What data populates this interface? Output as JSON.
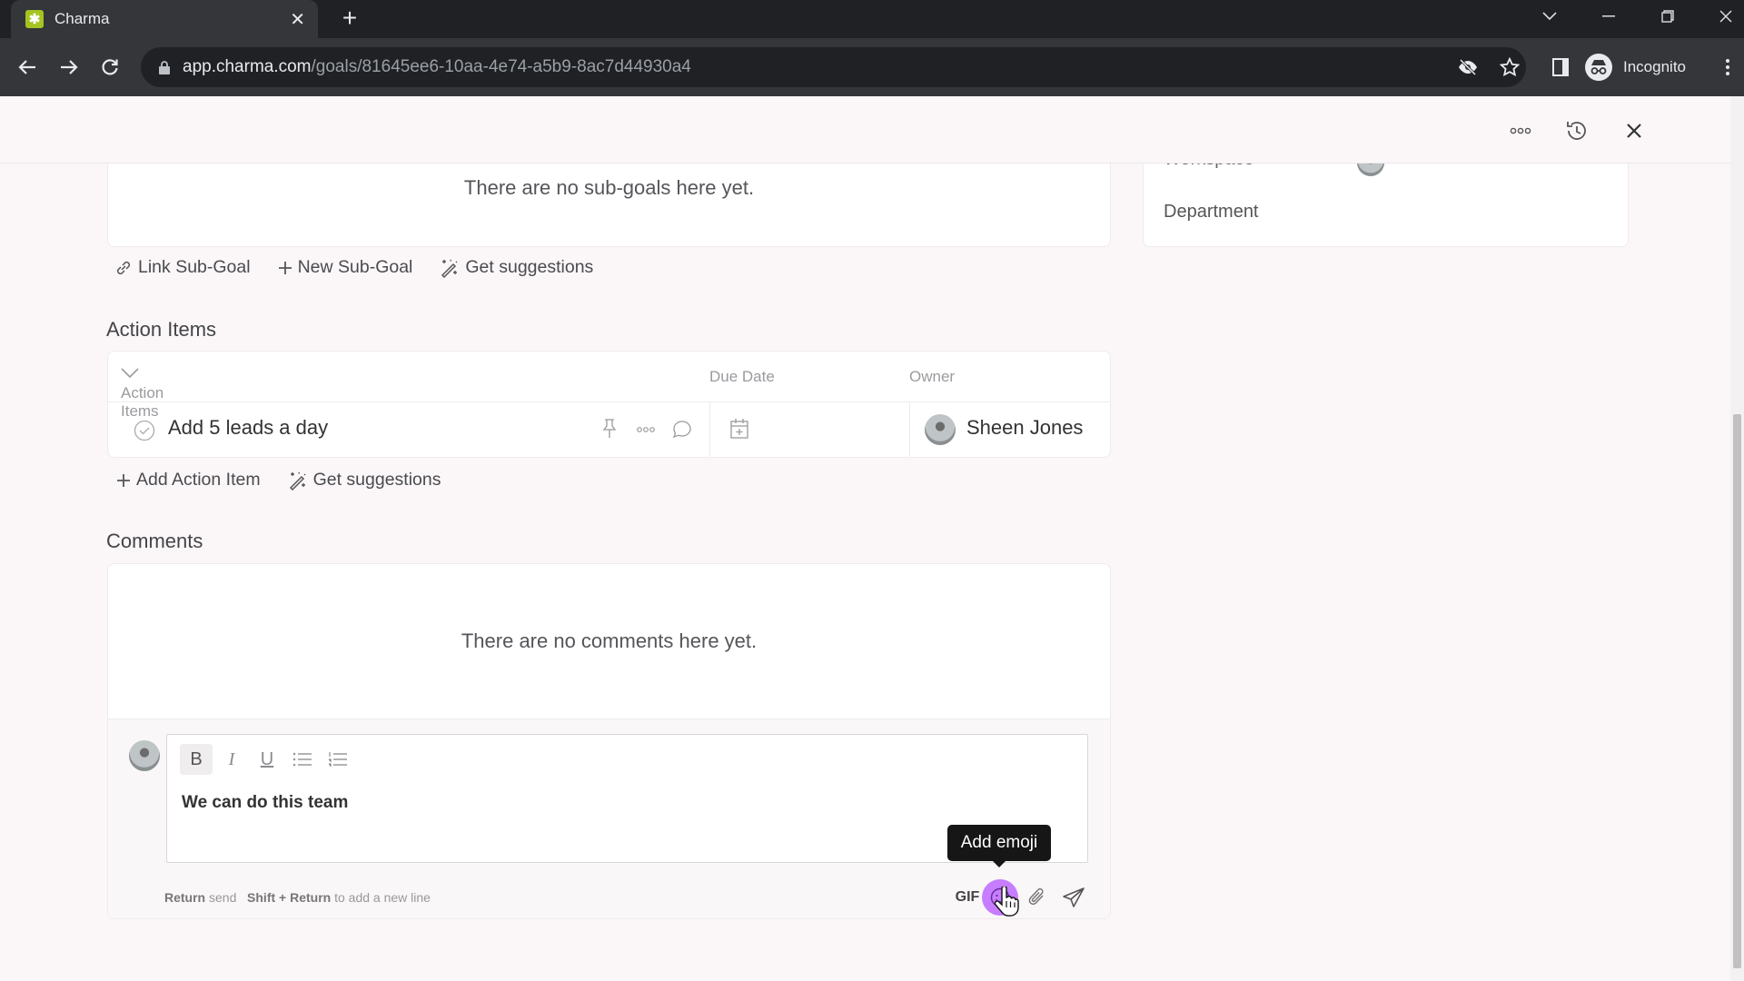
{
  "browser": {
    "tab_title": "Charma",
    "url_host": "app.charma.com",
    "url_path": "/goals/81645ee6-10aa-4e74-a5b9-8ac7d44930a4",
    "incognito_label": "Incognito"
  },
  "header": {
    "icons": [
      "more-icon",
      "history-icon",
      "close-icon"
    ]
  },
  "details_panel": {
    "workspace_label": "Workspace",
    "department_label": "Department"
  },
  "sub_goals": {
    "empty_text": "There are no sub-goals here yet.",
    "actions": {
      "link": "Link Sub-Goal",
      "new": "New Sub-Goal",
      "suggest": "Get suggestions"
    }
  },
  "action_items": {
    "section_title": "Action Items",
    "columns": {
      "items": "Action Items",
      "due_date": "Due Date",
      "owner": "Owner"
    },
    "rows": [
      {
        "name": "Add 5 leads a day",
        "due_date": "",
        "owner": "Sheen Jones"
      }
    ],
    "actions": {
      "add": "Add Action Item",
      "suggest": "Get suggestions"
    }
  },
  "comments": {
    "section_title": "Comments",
    "empty_text": "There are no comments here yet.",
    "composer": {
      "text": "We can do this team",
      "format_buttons": [
        "B",
        "I",
        "U"
      ],
      "hint_key1": "Return",
      "hint_text1": "send",
      "hint_key2": "Shift + Return",
      "hint_text2": "to add a new line",
      "gif_label": "GIF",
      "tooltip": "Add emoji"
    }
  },
  "colors": {
    "emoji_accent": "#c77dff",
    "favicon": "#a4c422"
  }
}
